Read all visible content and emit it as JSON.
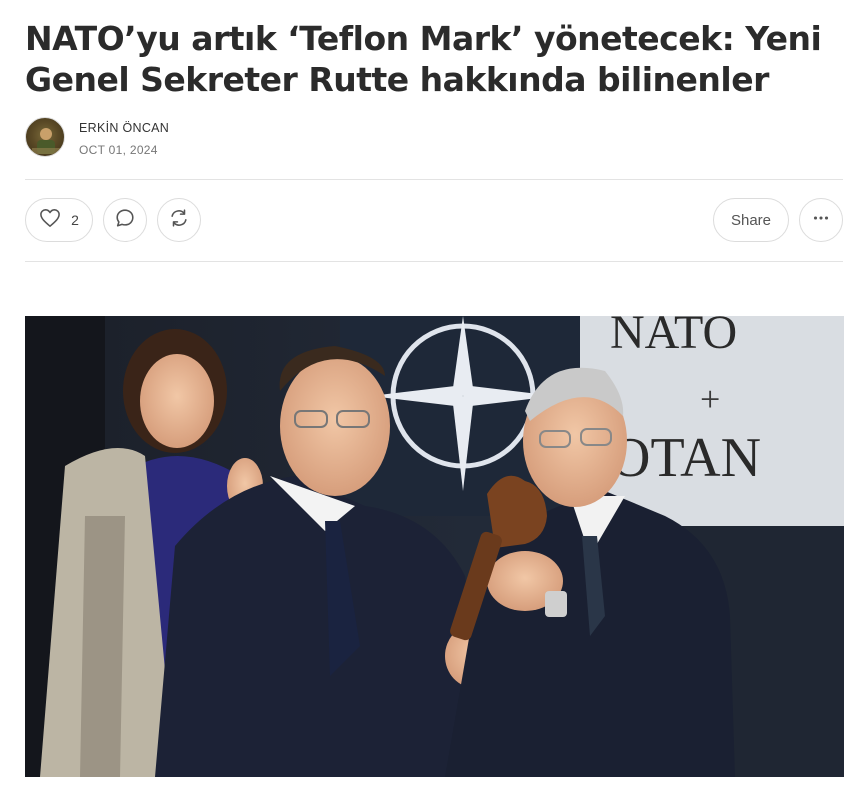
{
  "article": {
    "title": "NATO’yu artık ‘Teflon Mark’ yönetecek: Yeni Genel Sekreter Rutte hakkında bilinenler",
    "author": "ERKİN ÖNCAN",
    "date": "OCT 01, 2024"
  },
  "actions": {
    "like_count": "2",
    "share_label": "Share"
  },
  "photo": {
    "backdrop_text_top": "NATO",
    "backdrop_text_plus": "+",
    "backdrop_text_bottom": "OTAN"
  },
  "colors": {
    "title": "#2b2b2b",
    "border": "#dcdcdc",
    "muted": "#777777"
  }
}
